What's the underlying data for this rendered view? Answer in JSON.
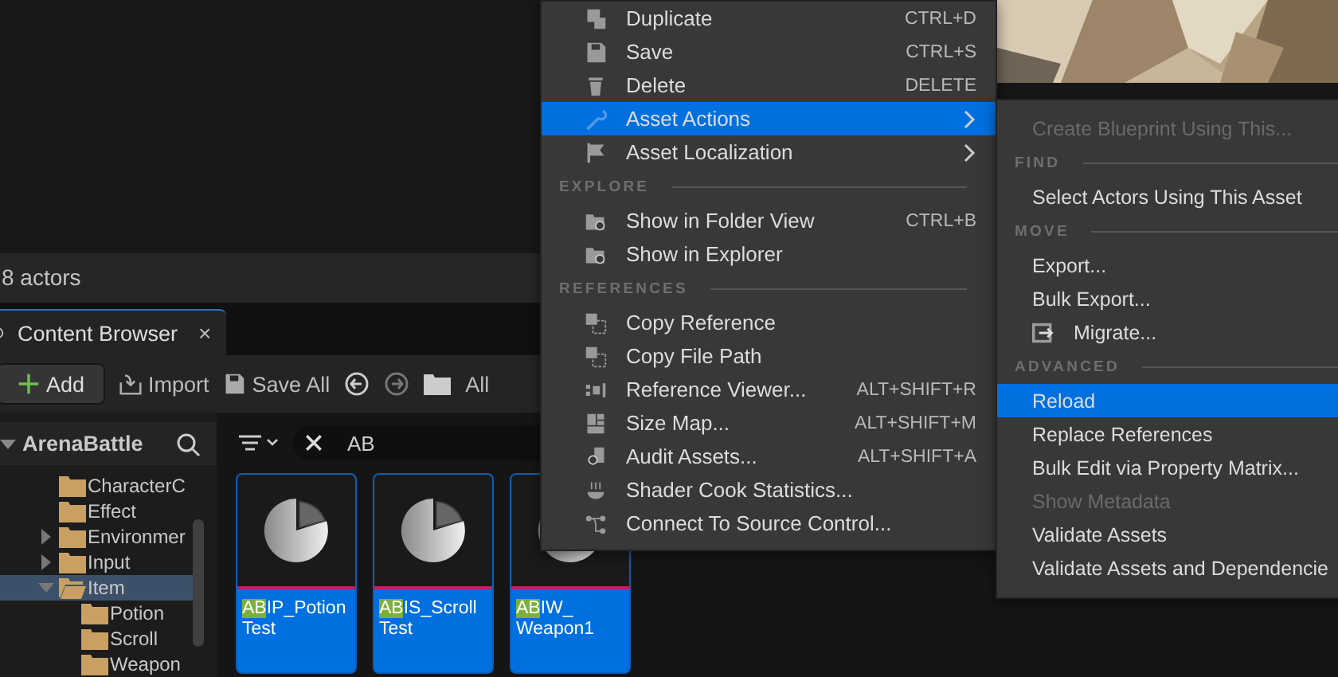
{
  "status_bar": {
    "text": "8 actors"
  },
  "tab": {
    "label": "Content Browser",
    "close": "×",
    "selected": true
  },
  "toolbar": {
    "add": "Add",
    "import": "Import",
    "save_all": "Save All",
    "path": "All"
  },
  "tree": {
    "root": "ArenaBattle",
    "items": [
      {
        "label": "CharacterC",
        "expanded": false,
        "has_children": false,
        "selected": false
      },
      {
        "label": "Effect",
        "expanded": false,
        "has_children": false,
        "selected": false
      },
      {
        "label": "Environmer",
        "expanded": false,
        "has_children": true,
        "selected": false
      },
      {
        "label": "Input",
        "expanded": false,
        "has_children": true,
        "selected": false
      },
      {
        "label": "Item",
        "expanded": true,
        "has_children": true,
        "selected": true,
        "children": [
          {
            "label": "Potion",
            "expanded": false,
            "has_children": false,
            "selected": false
          },
          {
            "label": "Scroll",
            "expanded": false,
            "has_children": false,
            "selected": false
          },
          {
            "label": "Weapon",
            "expanded": false,
            "has_children": false,
            "selected": false
          }
        ]
      }
    ]
  },
  "search": {
    "value": "AB"
  },
  "assets": [
    {
      "match": "AB",
      "rest": "IP_Potion",
      "line2": "Test",
      "selected": true
    },
    {
      "match": "AB",
      "rest": "IS_Scroll",
      "line2": "Test",
      "selected": true
    },
    {
      "match": "AB",
      "rest": "IW_",
      "line2": "Weapon1",
      "selected": true
    }
  ],
  "context_menu": {
    "items": [
      {
        "kind": "item",
        "label": "Duplicate",
        "shortcut": "CTRL+D",
        "selected": false,
        "submenu": false
      },
      {
        "kind": "item",
        "label": "Save",
        "shortcut": "CTRL+S",
        "selected": false,
        "submenu": false
      },
      {
        "kind": "item",
        "label": "Delete",
        "shortcut": "DELETE",
        "selected": false,
        "submenu": false
      },
      {
        "kind": "item",
        "label": "Asset Actions",
        "selected": true,
        "submenu": true
      },
      {
        "kind": "item",
        "label": "Asset Localization",
        "selected": false,
        "submenu": true
      },
      {
        "kind": "header",
        "label": "EXPLORE"
      },
      {
        "kind": "item",
        "label": "Show in Folder View",
        "shortcut": "CTRL+B",
        "selected": false,
        "submenu": false
      },
      {
        "kind": "item",
        "label": "Show in Explorer",
        "selected": false,
        "submenu": false
      },
      {
        "kind": "header",
        "label": "REFERENCES"
      },
      {
        "kind": "item",
        "label": "Copy Reference",
        "selected": false,
        "submenu": false
      },
      {
        "kind": "item",
        "label": "Copy File Path",
        "selected": false,
        "submenu": false
      },
      {
        "kind": "item",
        "label": "Reference Viewer...",
        "shortcut": "ALT+SHIFT+R",
        "selected": false,
        "submenu": false
      },
      {
        "kind": "item",
        "label": "Size Map...",
        "shortcut": "ALT+SHIFT+M",
        "selected": false,
        "submenu": false
      },
      {
        "kind": "item",
        "label": "Audit Assets...",
        "shortcut": "ALT+SHIFT+A",
        "selected": false,
        "submenu": false
      },
      {
        "kind": "item",
        "label": "Shader Cook Statistics...",
        "selected": false,
        "submenu": false
      },
      {
        "kind": "item",
        "label": "Connect To Source Control...",
        "selected": false,
        "submenu": false
      }
    ]
  },
  "submenu": {
    "items": [
      {
        "kind": "item",
        "label": "Create Blueprint Using This...",
        "disabled": true,
        "selected": false
      },
      {
        "kind": "header",
        "label": "FIND"
      },
      {
        "kind": "item",
        "label": "Select Actors Using This Asset",
        "disabled": false,
        "selected": false
      },
      {
        "kind": "header",
        "label": "MOVE"
      },
      {
        "kind": "item",
        "label": "Export...",
        "disabled": false,
        "selected": false
      },
      {
        "kind": "item",
        "label": "Bulk Export...",
        "disabled": false,
        "selected": false
      },
      {
        "kind": "item",
        "label": "Migrate...",
        "disabled": false,
        "selected": false
      },
      {
        "kind": "header",
        "label": "ADVANCED"
      },
      {
        "kind": "item",
        "label": "Reload",
        "disabled": false,
        "selected": true
      },
      {
        "kind": "item",
        "label": "Replace References",
        "disabled": false,
        "selected": false
      },
      {
        "kind": "item",
        "label": "Bulk Edit via Property Matrix...",
        "disabled": false,
        "selected": false
      },
      {
        "kind": "item",
        "label": "Show Metadata",
        "disabled": true,
        "selected": false
      },
      {
        "kind": "item",
        "label": "Validate Assets",
        "disabled": false,
        "selected": false
      },
      {
        "kind": "item",
        "label": "Validate Assets and Dependencie",
        "disabled": false,
        "selected": false
      }
    ]
  }
}
